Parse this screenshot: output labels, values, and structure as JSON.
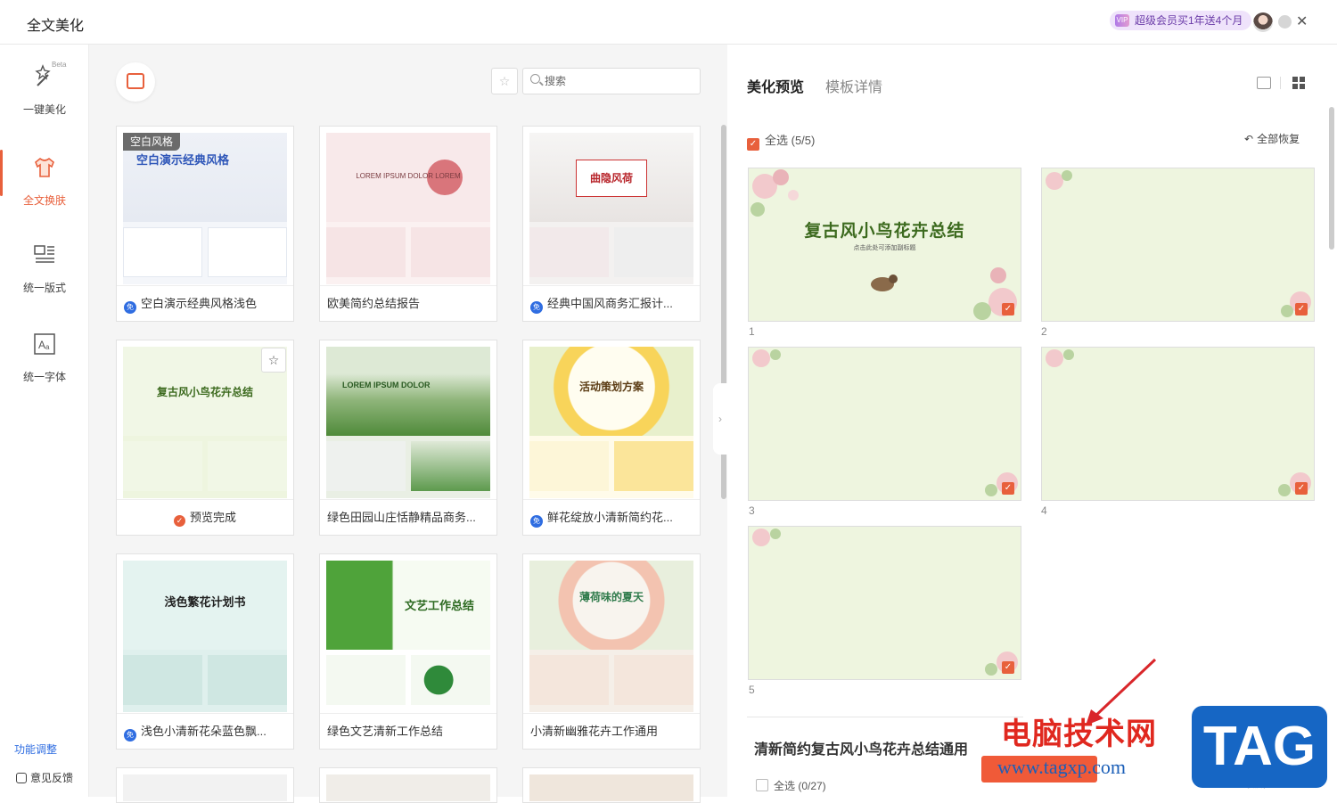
{
  "app": {
    "title": "全文美化"
  },
  "header": {
    "vip_promo": "超级会员买1年送4个月"
  },
  "sidebar": {
    "items": [
      {
        "label": "一键美化",
        "badge": "Beta"
      },
      {
        "label": "全文换肤"
      },
      {
        "label": "统一版式"
      },
      {
        "label": "统一字体"
      }
    ],
    "footer": {
      "adjust": "功能调整",
      "feedback": "意见反馈"
    }
  },
  "search": {
    "placeholder": "搜索"
  },
  "templates": [
    {
      "name": "空白演示经典风格浅色",
      "free": true,
      "tag": "空白风格",
      "thumb_title": "空白演示经典风格"
    },
    {
      "name": "欧美简约总结报告",
      "free": false,
      "thumb_title": "LOREM IPSUM DOLOR LOREM"
    },
    {
      "name": "经典中国风商务汇报计...",
      "free": true,
      "thumb_title": "曲隐风荷"
    },
    {
      "name": "预览完成",
      "free": false,
      "done": true,
      "thumb_title": "复古风小鸟花卉总结"
    },
    {
      "name": "绿色田园山庄恬静精品商务...",
      "free": false,
      "thumb_title": "LOREM IPSUM DOLOR"
    },
    {
      "name": "鲜花绽放小清新简约花...",
      "free": true,
      "thumb_title": "活动策划方案"
    },
    {
      "name": "浅色小清新花朵蓝色飘...",
      "free": true,
      "thumb_title": "浅色繁花计划书"
    },
    {
      "name": "绿色文艺清新工作总结",
      "free": false,
      "thumb_title": "文艺工作总结"
    },
    {
      "name": "小清新幽雅花卉工作通用",
      "free": false,
      "thumb_title": "薄荷味的夏天"
    }
  ],
  "preview": {
    "tabs": [
      "美化预览",
      "模板详情"
    ],
    "select_all": "全选 (5/5)",
    "restore_all": "全部恢复",
    "slide_title": "复古风小鸟花卉总结",
    "slide_subtitle": "点击此处可添加副标题",
    "slides": [
      "1",
      "2",
      "3",
      "4",
      "5"
    ]
  },
  "bottom": {
    "template_title": "清新简约复古风小鸟花卉总结通用",
    "select_all": "全选 (0/27)",
    "favorite": "收藏"
  },
  "watermark": {
    "text": "电脑技术网",
    "url": "www.tagxp.com",
    "logo": "TAG"
  },
  "colors": {
    "accent": "#e8603c",
    "free_badge": "#2f6de1",
    "slide_bg": "#eef5df",
    "slide_title": "#3c6a1e"
  }
}
